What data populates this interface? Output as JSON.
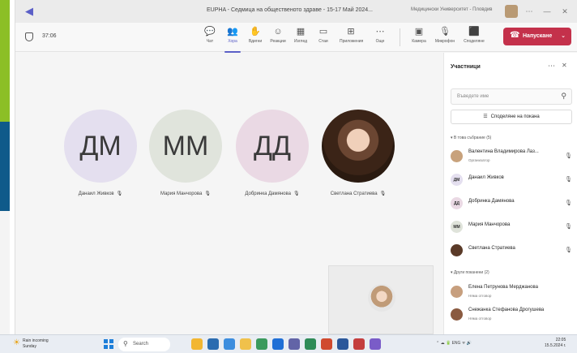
{
  "window": {
    "title": "EUPHA - Седмица на общественото здраве - 15-17 Май 2024...",
    "org": "Медицински Университет - Пловдив"
  },
  "toolbar": {
    "timer": "37:06",
    "tools": [
      {
        "icon": "chat-icon",
        "label": "Чат"
      },
      {
        "icon": "people-icon",
        "label": "Хора"
      },
      {
        "icon": "raise-hand-icon",
        "label": "Вдигни"
      },
      {
        "icon": "reactions-icon",
        "label": "Реакции"
      },
      {
        "icon": "view-icon",
        "label": "Изглед"
      },
      {
        "icon": "rooms-icon",
        "label": "Стаи"
      },
      {
        "icon": "apps-icon",
        "label": "Приложения"
      },
      {
        "icon": "more-icon",
        "label": "Още"
      }
    ],
    "devices": [
      {
        "icon": "camera-icon",
        "label": "Камера"
      },
      {
        "icon": "mic-icon",
        "label": "Микрофон"
      },
      {
        "icon": "share-icon",
        "label": "Споделяне"
      }
    ],
    "leave_label": "Напускане"
  },
  "stage": {
    "tiles": [
      {
        "initials": "ДМ",
        "name": "Данаил Живков",
        "color": "#e4dfef"
      },
      {
        "initials": "ММ",
        "name": "Мария Манчорова",
        "color": "#e0e4dc"
      },
      {
        "initials": "ДД",
        "name": "Добринка Дамянова",
        "color": "#ead9e4"
      },
      {
        "initials": "",
        "name": "Светлана Стратиева",
        "color": "#3b2417"
      }
    ]
  },
  "panel": {
    "title": "Участници",
    "search_placeholder": "Въведете име",
    "share_label": "Споделяне на покана",
    "in_meeting_header": "В това събрание (5)",
    "others_header": "Други поканени (2)",
    "participants": [
      {
        "initials": "",
        "name": "Валентина Владимирова Лаз...",
        "sub": "Организатор",
        "color": "#c8a27c"
      },
      {
        "initials": "ДМ",
        "name": "Данаил Живков",
        "sub": "",
        "color": "#e4dfef"
      },
      {
        "initials": "ДД",
        "name": "Добринка Дамянова",
        "sub": "",
        "color": "#ead9e4"
      },
      {
        "initials": "ММ",
        "name": "Мария Манчорова",
        "sub": "",
        "color": "#dfe3da"
      },
      {
        "initials": "",
        "name": "Светлана Стратиева",
        "sub": "",
        "color": "#5a3a28"
      }
    ],
    "others": [
      {
        "initials": "",
        "name": "Елена Петрунова Мерджанова",
        "sub": "Няма отговор",
        "color": "#c79f7e"
      },
      {
        "initials": "",
        "name": "Снежанка Стефанова Дрогушева",
        "sub": "Няма отговор",
        "color": "#8a5a40"
      }
    ]
  },
  "taskbar": {
    "weather_line1": "Rain incoming",
    "weather_line2": "Sunday",
    "search_label": "Search",
    "tray": "ENG",
    "time": "22:05",
    "date": "15.5.2024 г."
  }
}
